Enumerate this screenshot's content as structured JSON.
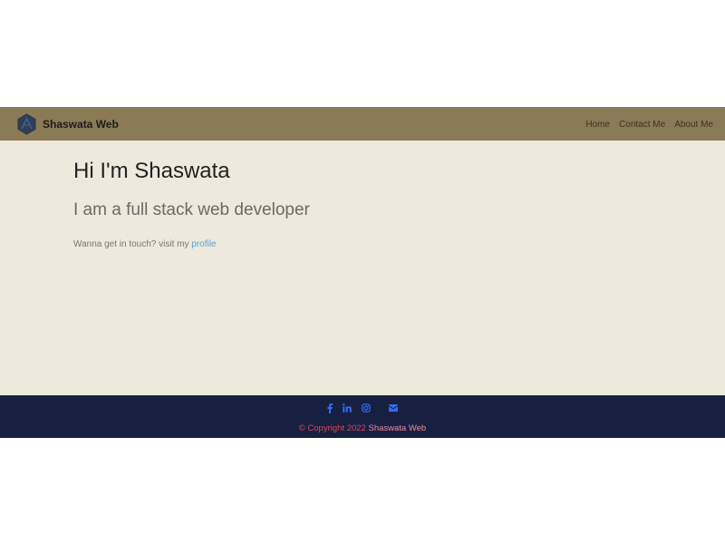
{
  "navbar": {
    "brand_name": "Shaswata Web",
    "links": [
      {
        "label": "Home"
      },
      {
        "label": "Contact Me"
      },
      {
        "label": "About Me"
      }
    ]
  },
  "hero": {
    "title": "Hi I'm Shaswata",
    "subtitle": "I am a full stack web developer",
    "cta_text": "Wanna get in touch? visit my ",
    "cta_link": "profile"
  },
  "footer": {
    "social_icons": [
      "facebook-icon",
      "linkedin-icon",
      "instagram-icon",
      "email-icon"
    ],
    "copyright_prefix": "© Copyright 2022 ",
    "copyright_brand": "Shaswata Web"
  },
  "colors": {
    "navbar_bg": "#8a7a55",
    "hero_bg": "#ede9dc",
    "footer_bg": "#172040",
    "social_icon": "#2f6df6",
    "copyright_text": "#d9455f",
    "link": "#5b9fd6"
  }
}
